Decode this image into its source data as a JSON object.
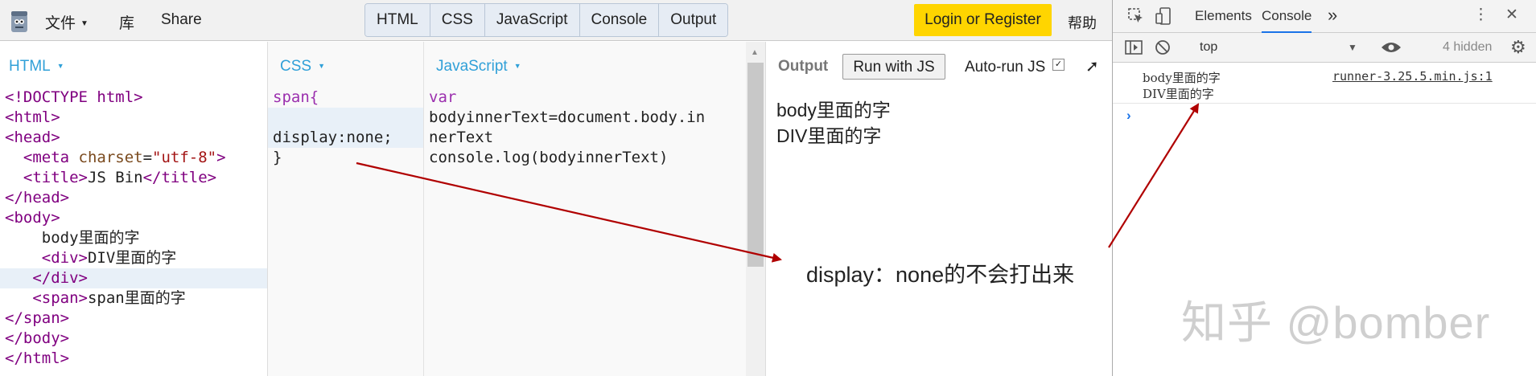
{
  "menu": {
    "file_label": "文件",
    "library_label": "库",
    "share_label": "Share"
  },
  "panel_tabs": [
    "HTML",
    "CSS",
    "JavaScript",
    "Console",
    "Output"
  ],
  "login_label": "Login or Register",
  "help_label": "帮助",
  "html_pane": {
    "label": "HTML",
    "lines": [
      "<!DOCTYPE html>",
      "<html>",
      "<head>",
      "  <meta charset=\"utf-8\">",
      "  <title>JS Bin</title>",
      "</head>",
      "<body>",
      "    body里面的字",
      "    <div>DIV里面的字",
      "   </div>",
      "   <span>span里面的字",
      "</span>",
      "</body>",
      "</html>"
    ]
  },
  "css_pane": {
    "label": "CSS",
    "lines": [
      "span{",
      "",
      "display:none;",
      "}"
    ]
  },
  "js_pane": {
    "label": "JavaScript",
    "lines": [
      "var",
      "bodyinnerText=document.body.in",
      "nerText",
      "console.log(bodyinnerText)"
    ]
  },
  "output": {
    "label": "Output",
    "run_button": "Run with JS",
    "autorun_label": "Auto-run JS",
    "autorun_checked": true,
    "lines": [
      "body里面的字",
      "DIV里面的字"
    ]
  },
  "annotation": "display：none的不会打出来",
  "devtools": {
    "tabs": [
      "Elements",
      "Console"
    ],
    "active_tab": "Console",
    "more_tabs": "»",
    "context": "top",
    "hidden_count": "4 hidden",
    "log_lines": [
      "body里面的字",
      "DIV里面的字"
    ],
    "log_source": "runner-3.25.5.min.js:1",
    "prompt": "›"
  },
  "watermark": "知乎 @bomber",
  "colors": {
    "login_bg": "#ffd500",
    "pane_label": "#30a0d8",
    "arrow": "#b00000",
    "active_tab_underline": "#1a73e8"
  }
}
